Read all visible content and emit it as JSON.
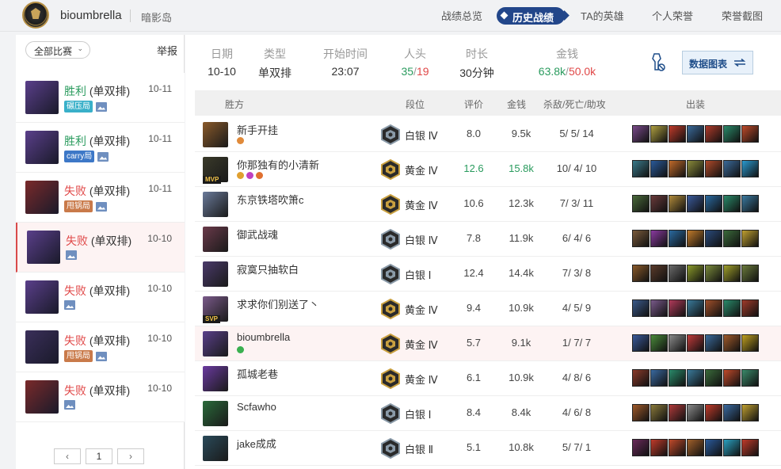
{
  "header": {
    "username": "bioumbrella",
    "region": "暗影岛",
    "nav": [
      {
        "label": "战绩总览",
        "active": false
      },
      {
        "label": "历史战绩",
        "active": true
      },
      {
        "label": "TA的英雄",
        "active": false
      },
      {
        "label": "个人荣誉",
        "active": false
      },
      {
        "label": "荣誉截图",
        "active": false
      }
    ]
  },
  "sidebar": {
    "filter_label": "全部比赛",
    "report_label": "举报",
    "matches": [
      {
        "result": "胜利",
        "mode": "(单双排)",
        "date": "10-11",
        "tag": "碾压局",
        "tag_color": "#39b0c9",
        "win": true,
        "avatar_color": "#5a3f8a"
      },
      {
        "result": "胜利",
        "mode": "(单双排)",
        "date": "10-11",
        "tag": "carry局",
        "tag_color": "#3d78c7",
        "win": true,
        "avatar_color": "#5a3f8a"
      },
      {
        "result": "失败",
        "mode": "(单双排)",
        "date": "10-11",
        "tag": "甩锅局",
        "tag_color": "#c97a4a",
        "win": false,
        "avatar_color": "#7a2a2a"
      },
      {
        "result": "失败",
        "mode": "(单双排)",
        "date": "10-10",
        "tag": "",
        "tag_color": "",
        "win": false,
        "avatar_color": "#5a3f8a",
        "active": true
      },
      {
        "result": "失败",
        "mode": "(单双排)",
        "date": "10-10",
        "tag": "",
        "tag_color": "",
        "win": false,
        "avatar_color": "#5a3f8a"
      },
      {
        "result": "失败",
        "mode": "(单双排)",
        "date": "10-10",
        "tag": "甩锅局",
        "tag_color": "#c97a4a",
        "win": false,
        "avatar_color": "#3a2f5a"
      },
      {
        "result": "失败",
        "mode": "(单双排)",
        "date": "10-10",
        "tag": "",
        "tag_color": "",
        "win": false,
        "avatar_color": "#7a2a2a"
      }
    ],
    "pager": {
      "prev": "‹",
      "page": "1",
      "next": "›"
    }
  },
  "summary": {
    "date_label": "日期",
    "date": "10-10",
    "type_label": "类型",
    "type": "单双排",
    "start_label": "开始时间",
    "start": "23:07",
    "kills_label": "人头",
    "kills_a": "35",
    "kills_b": "19",
    "duration_label": "时长",
    "duration": "30分钟",
    "gold_label": "金钱",
    "gold_a": "63.8k",
    "gold_b": "50.0k",
    "chart_button": "数据图表"
  },
  "table": {
    "headers": {
      "team": "胜方",
      "rank": "段位",
      "score": "评价",
      "gold": "金钱",
      "kda": "杀敌/死亡/助攻",
      "items": "出装"
    },
    "rows": [
      {
        "name": "新手开挂",
        "rank": "白银 Ⅳ",
        "tier": "silver",
        "score": "8.0",
        "gold": "9.5k",
        "kda": "5/ 5/ 14",
        "champ": "#8a5a2a",
        "badges": [
          "#e08a3a"
        ],
        "items": [
          "#7a4a8a",
          "#b0a040",
          "#c03a2a",
          "#3a6a9a",
          "#b03a2a",
          "#2a8a6a",
          "#c04a2a"
        ]
      },
      {
        "name": "你那独有的小清新",
        "rank": "黄金 Ⅳ",
        "tier": "gold",
        "score": "12.6",
        "gold": "15.8k",
        "kda": "10/ 4/ 10",
        "champ": "#3a3a2a",
        "badge_text": "MVP",
        "highlight": true,
        "badges": [
          "#e0a030",
          "#c040c0",
          "#e07030"
        ],
        "items": [
          "#3a7a8a",
          "#2a5a9a",
          "#c06a2a",
          "#8a8a3a",
          "#b04a2a",
          "#3a6a9a",
          "#2a9ad0"
        ]
      },
      {
        "name": "东京铁塔吹箫c",
        "rank": "黄金 Ⅳ",
        "tier": "gold",
        "score": "10.6",
        "gold": "12.3k",
        "kda": "7/ 3/ 11",
        "champ": "#6a7a9a",
        "badges": [],
        "items": [
          "#4a6a3a",
          "#6a3a3a",
          "#b08a3a",
          "#3a5a9a",
          "#2a6aa0",
          "#2a8a6a",
          "#3a7aa0"
        ]
      },
      {
        "name": "御武战魂",
        "rank": "白银 Ⅳ",
        "tier": "silver",
        "score": "7.8",
        "gold": "11.9k",
        "kda": "6/ 4/ 6",
        "champ": "#6a3a4a",
        "badges": [],
        "items": [
          "#7a5a3a",
          "#8a3aa0",
          "#2a6aa0",
          "#c07a2a",
          "#2a4a7a",
          "#3a6a3a",
          "#c0a030"
        ]
      },
      {
        "name": "寂寞只抽软白",
        "rank": "白银 Ⅰ",
        "tier": "silver",
        "score": "12.4",
        "gold": "14.4k",
        "kda": "7/ 3/ 8",
        "champ": "#4a3a6a",
        "badges": [],
        "items": [
          "#8a5a2a",
          "#5a3a2a",
          "#6a6a6a",
          "#8a9a2a",
          "#7a8a3a",
          "#a0a02a",
          "#6a7a3a"
        ]
      },
      {
        "name": "求求你们别送了丶",
        "rank": "黄金 Ⅳ",
        "tier": "gold",
        "score": "9.4",
        "gold": "10.9k",
        "kda": "4/ 5/ 9",
        "champ": "#7a5a8a",
        "badge_text": "SVP",
        "badges": [],
        "items": [
          "#3a5a8a",
          "#7a5a8a",
          "#b03a5a",
          "#3a7a9a",
          "#a0502a",
          "#2a8a6a",
          "#a03a2a"
        ]
      },
      {
        "name": "bioumbrella",
        "rank": "黄金 Ⅳ",
        "tier": "gold",
        "score": "5.7",
        "gold": "9.1k",
        "kda": "1/ 7/ 7",
        "champ": "#5a3f8a",
        "self": true,
        "badges": [
          "#3ab050"
        ],
        "items": [
          "#3a5a9a",
          "#4a8a3a",
          "#8a8a8a",
          "#c03a3a",
          "#3a6a9a",
          "#a05a2a",
          "#c0a020"
        ]
      },
      {
        "name": "孤城老巷",
        "rank": "黄金 Ⅳ",
        "tier": "gold",
        "score": "6.1",
        "gold": "10.9k",
        "kda": "4/ 8/ 6",
        "champ": "#6a3aa0",
        "badges": [],
        "items": [
          "#8a3a2a",
          "#3a6aa0",
          "#2a8a6a",
          "#3a7a9a",
          "#3a6a3a",
          "#c04a2a",
          "#3a8a6a"
        ]
      },
      {
        "name": "Scfawho",
        "rank": "白银 Ⅰ",
        "tier": "silver",
        "score": "8.4",
        "gold": "8.4k",
        "kda": "4/ 6/ 8",
        "champ": "#2a6a3a",
        "badges": [],
        "items": [
          "#a05a2a",
          "#8a7a3a",
          "#b03a3a",
          "#8a8a8a",
          "#c03a2a",
          "#3a6aa0",
          "#c0a030"
        ]
      },
      {
        "name": "jake成成",
        "rank": "白银 Ⅱ",
        "tier": "silver",
        "score": "5.1",
        "gold": "10.8k",
        "kda": "5/ 7/ 1",
        "champ": "#2a4a5a",
        "badges": [],
        "items": [
          "#6a2a5a",
          "#c03a2a",
          "#c04a2a",
          "#a0602a",
          "#2a5a9a",
          "#2aa0c0",
          "#c03a2a"
        ]
      }
    ]
  }
}
